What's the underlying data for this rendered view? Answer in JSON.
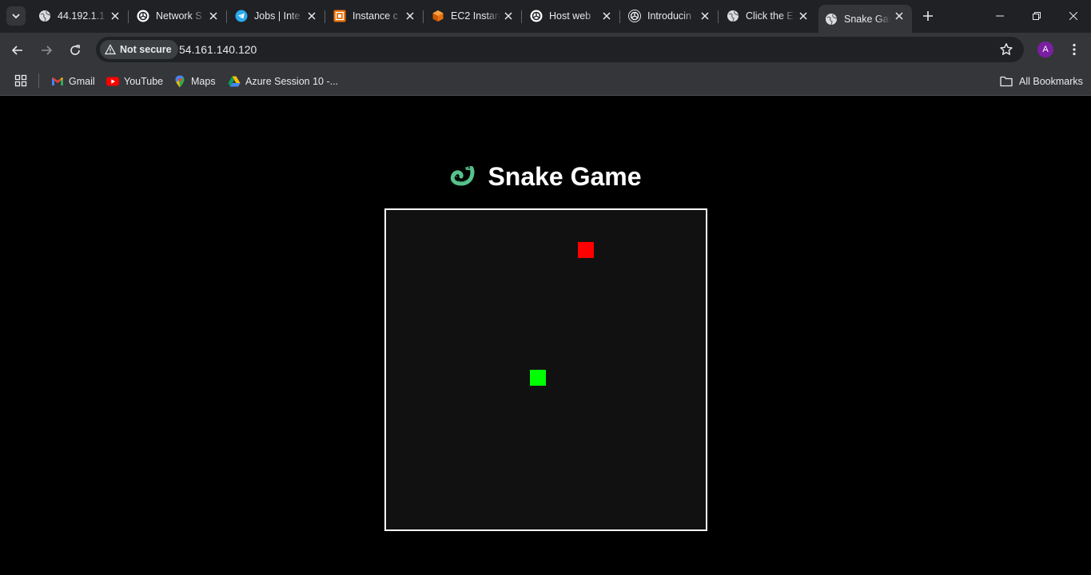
{
  "browser": {
    "tabs": [
      {
        "title": "44.192.1.1",
        "icon": "globe-icon"
      },
      {
        "title": "Network S",
        "icon": "openai-icon"
      },
      {
        "title": "Jobs | Inte",
        "icon": "telegram-icon"
      },
      {
        "title": "Instance c",
        "icon": "aws-icon"
      },
      {
        "title": "EC2 Instan",
        "icon": "ec2-icon"
      },
      {
        "title": "Host web",
        "icon": "openai-icon"
      },
      {
        "title": "Introducin",
        "icon": "openai-icon"
      },
      {
        "title": "Click the E",
        "icon": "globe-icon"
      },
      {
        "title": "Snake Gar",
        "icon": "globe-icon",
        "active": true
      }
    ],
    "security_chip": "Not secure",
    "url": "54.161.140.120",
    "profile_initial": "A",
    "bookmarks": [
      {
        "label": "Gmail",
        "icon": "gmail-icon"
      },
      {
        "label": "YouTube",
        "icon": "youtube-icon"
      },
      {
        "label": "Maps",
        "icon": "maps-icon"
      },
      {
        "label": "Azure Session 10 -...",
        "icon": "drive-icon"
      }
    ],
    "all_bookmarks_label": "All Bookmarks"
  },
  "page": {
    "title": "Snake Game",
    "title_emoji": "snake",
    "board": {
      "grid_size": 20,
      "background": "#111111",
      "border_color": "#ffffff",
      "snake": [
        {
          "col": 9,
          "row": 10
        }
      ],
      "snake_color": "#00ff00",
      "food": {
        "col": 12,
        "row": 2
      },
      "food_color": "#ff0000"
    }
  }
}
